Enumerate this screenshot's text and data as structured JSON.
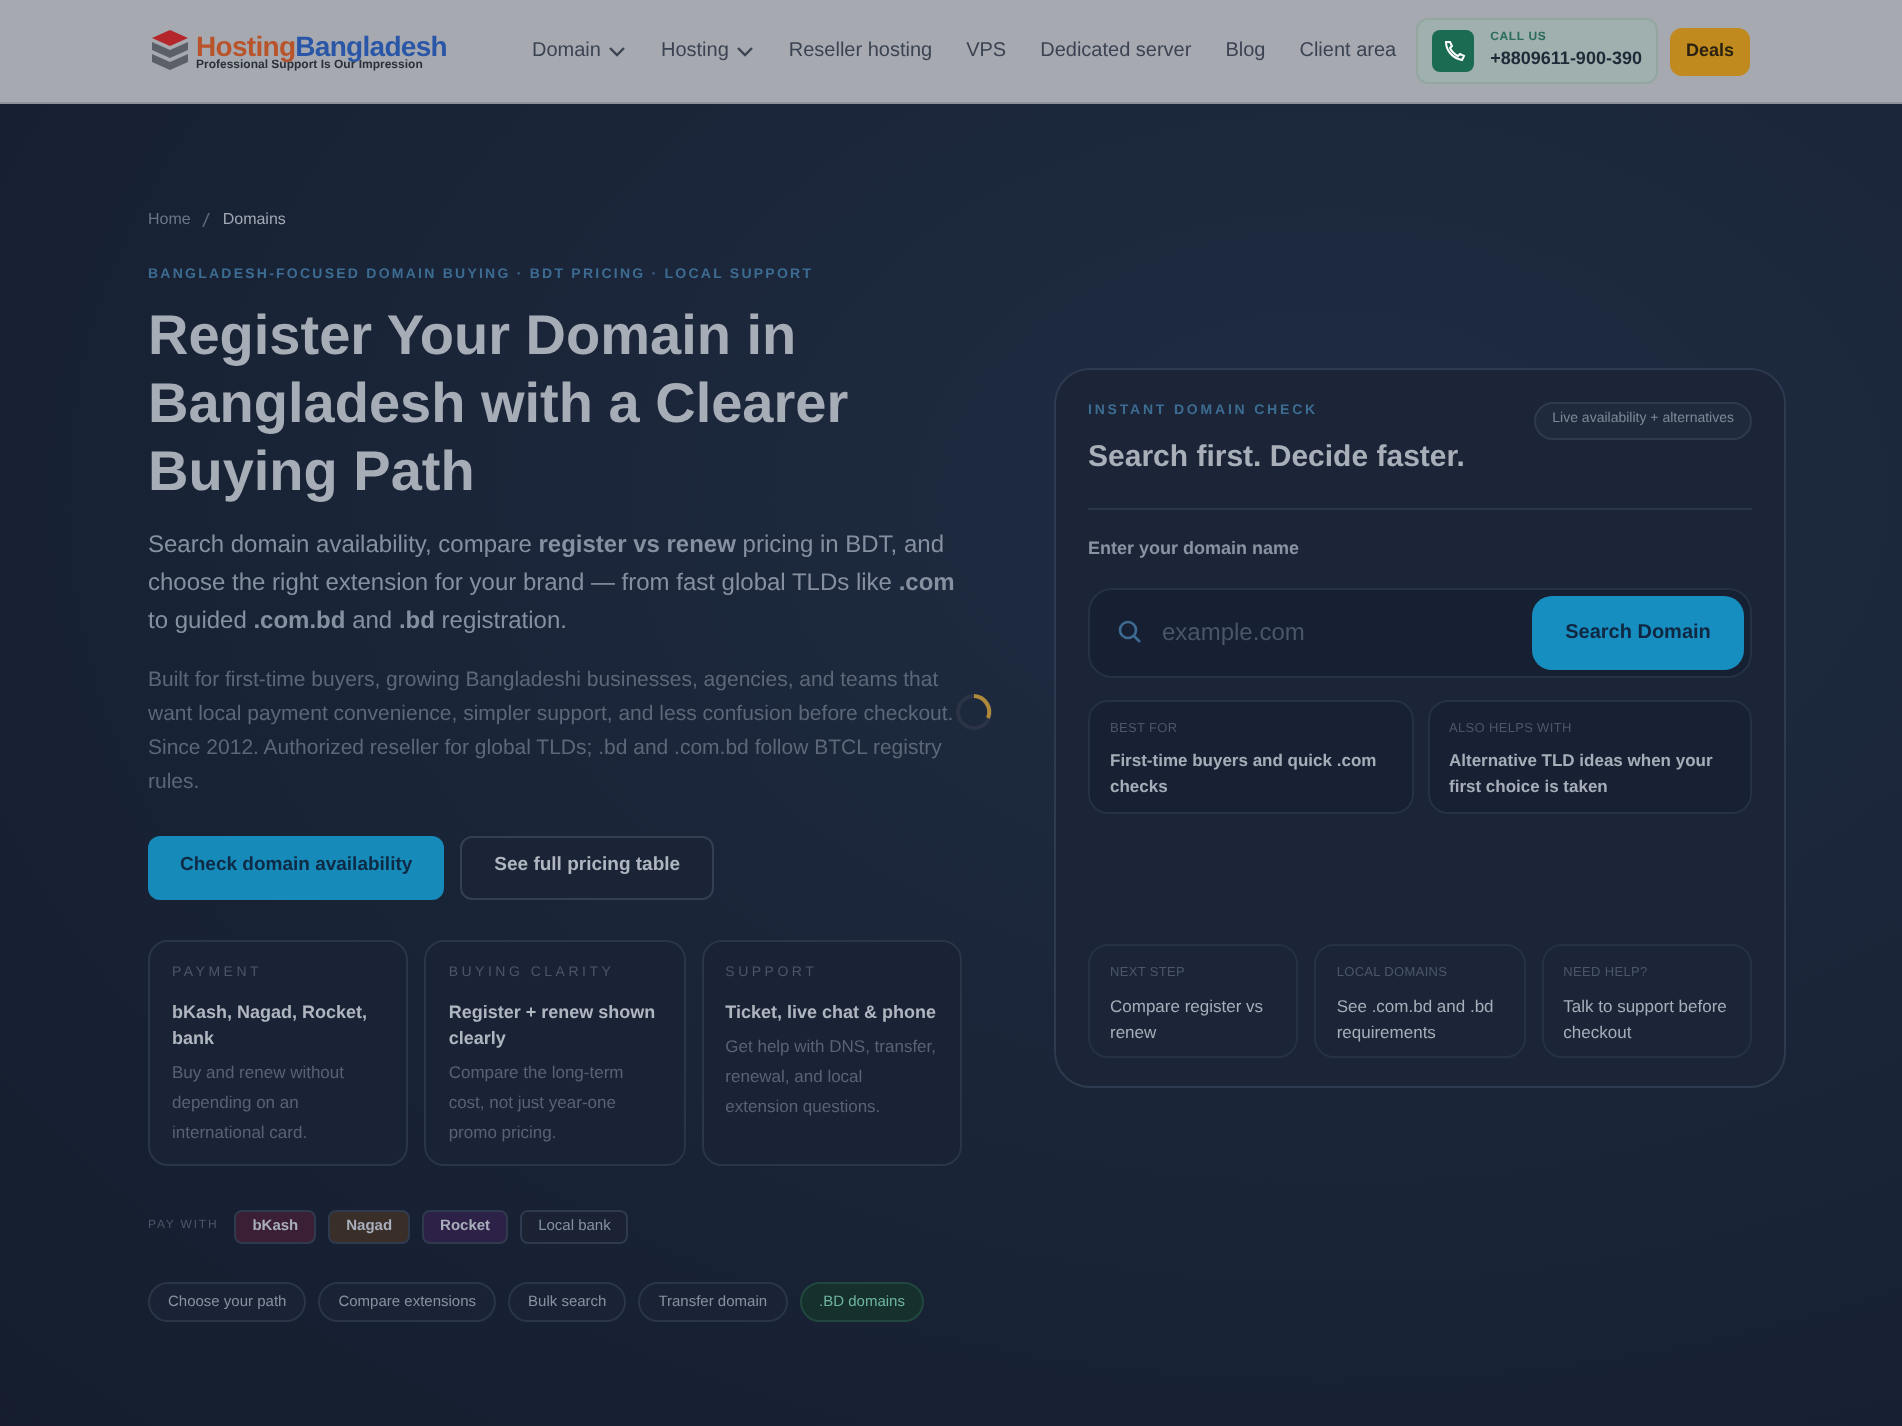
{
  "header": {
    "logo": {
      "brand_first": "Hosting",
      "brand_second": "Bangladesh",
      "tagline": "Professional Support Is Our Impression"
    },
    "nav": [
      {
        "label": "Domain",
        "has_menu": true
      },
      {
        "label": "Hosting",
        "has_menu": true
      },
      {
        "label": "Reseller hosting",
        "has_menu": false
      },
      {
        "label": "VPS",
        "has_menu": false
      },
      {
        "label": "Dedicated server",
        "has_menu": false
      },
      {
        "label": "Blog",
        "has_menu": false
      },
      {
        "label": "Client area",
        "has_menu": false
      }
    ],
    "call": {
      "label": "CALL US",
      "number": "+8809611-900-390"
    },
    "deals_button": "Deals"
  },
  "breadcrumb": [
    "Home",
    "Domains"
  ],
  "eyebrow": "BANGLADESH-FOCUSED DOMAIN BUYING · BDT PRICING · LOCAL SUPPORT",
  "headline": "Register Your Domain in Bangladesh with a Clearer Buying Path",
  "lead": "Search domain availability, compare **register vs renew** pricing in BDT, and choose the right extension for your brand — from fast global TLDs like **.com** to guided **.com.bd** and **.bd** registration.",
  "description": "Built for first-time buyers, growing Bangladeshi businesses, agencies, and teams that want local payment convenience, simpler support, and less confusion before checkout. Since 2012. Authorized reseller for global TLDs; .bd and .com.bd follow BTCL registry rules.",
  "buttons": [
    {
      "label": "Check domain availability",
      "kind": "primary"
    },
    {
      "label": "See full pricing table",
      "kind": "secondary"
    }
  ],
  "features": [
    {
      "label": "PAYMENT",
      "title": "bKash, Nagad, Rocket, bank",
      "text": "Buy and renew without depending on an international card."
    },
    {
      "label": "BUYING CLARITY",
      "title": "Register + renew shown clearly",
      "text": "Compare the long-term cost, not just year-one promo pricing."
    },
    {
      "label": "SUPPORT",
      "title": "Ticket, live chat & phone",
      "text": "Get help with DNS, transfer, renewal, and local extension questions."
    }
  ],
  "pay_with": {
    "label": "PAY WITH",
    "methods": [
      {
        "name": "bKash",
        "color": "#3a1f35"
      },
      {
        "name": "Nagad",
        "color": "#3a2f28"
      },
      {
        "name": "Rocket",
        "color": "#2e2148"
      },
      {
        "name": "Local bank",
        "color": "#1a2233"
      }
    ]
  },
  "paths": [
    {
      "label": "Choose your path",
      "selected": false
    },
    {
      "label": "Compare extensions",
      "selected": false
    },
    {
      "label": "Bulk search",
      "selected": false
    },
    {
      "label": "Transfer domain",
      "selected": false
    },
    {
      "label": ".BD domains",
      "selected": true
    }
  ],
  "search_card": {
    "eyebrow": "INSTANT DOMAIN CHECK",
    "badge": "Live availability + alternatives",
    "title": "Search first. Decide faster.",
    "field_label": "Enter your domain name",
    "placeholder": "example.com",
    "button": "Search Domain",
    "info": [
      {
        "label": "BEST FOR",
        "text": "First-time buyers and quick .com checks"
      },
      {
        "label": "ALSO HELPS WITH",
        "text": "Alternative TLD ideas when your first choice is taken"
      }
    ],
    "steps": [
      {
        "label": "NEXT STEP",
        "text": "Compare register vs renew"
      },
      {
        "label": "LOCAL DOMAINS",
        "text": "See .com.bd and .bd requirements"
      },
      {
        "label": "NEED HELP?",
        "text": "Talk to support before checkout"
      }
    ]
  }
}
